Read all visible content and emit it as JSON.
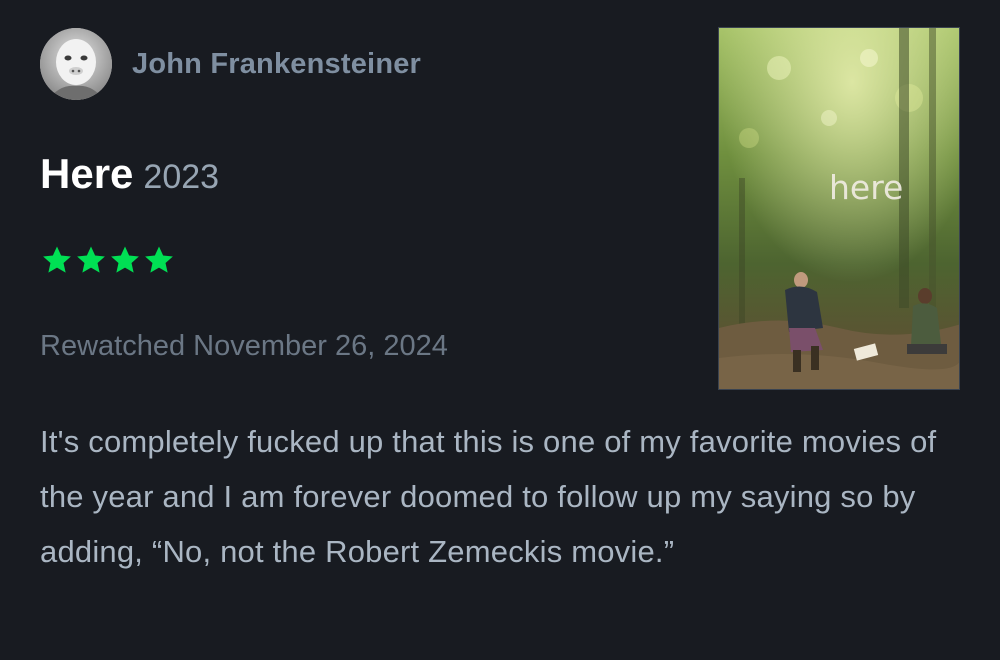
{
  "review": {
    "author": {
      "name": "John Frankensteiner",
      "avatar_icon": "user-avatar-icon"
    },
    "film": {
      "title": "Here",
      "year": "2023",
      "poster_title": "here"
    },
    "rating": {
      "stars": 4,
      "max_shown": 4,
      "star_color": "#00e054"
    },
    "date_text": "Rewatched November 26, 2024",
    "body": "It's completely fucked up that this is one of my favorite movies of the year and I am forever doomed to follow up my saying so by adding, “No, not the Robert Zemeckis movie.”"
  },
  "colors": {
    "background": "#181b21",
    "author_name": "#7f8fa1",
    "title": "#ffffff",
    "year": "#97a5b3",
    "date": "#6b7785",
    "body": "#aab6c3",
    "accent_green": "#00e054"
  }
}
